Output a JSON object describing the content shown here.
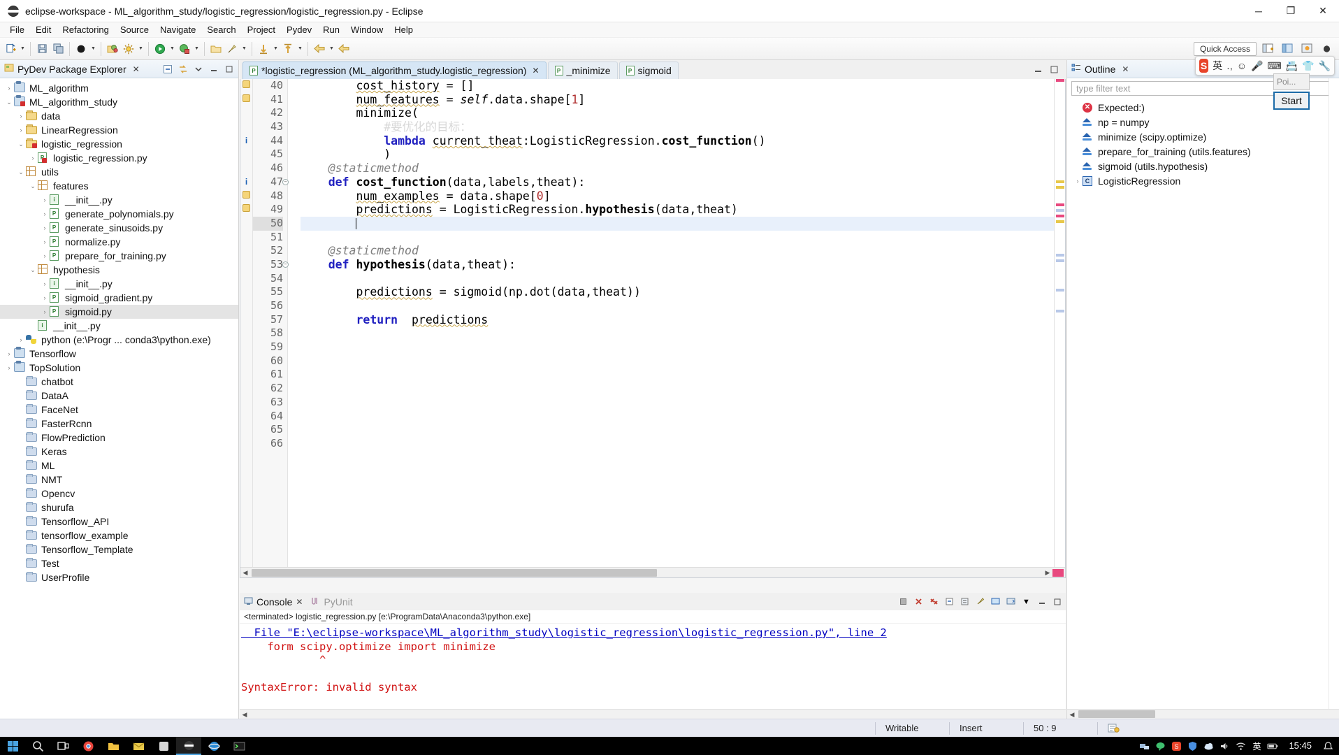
{
  "window": {
    "title": "eclipse-workspace - ML_algorithm_study/logistic_regression/logistic_regression.py - Eclipse",
    "minimize": "─",
    "maximize": "❐",
    "close": "✕"
  },
  "menubar": {
    "items": [
      "File",
      "Edit",
      "Refactoring",
      "Source",
      "Navigate",
      "Search",
      "Project",
      "Pydev",
      "Run",
      "Window",
      "Help"
    ]
  },
  "toolbar": {
    "quick_access_label": "Quick Access",
    "icons": [
      "new-wizard-icon",
      "save-icon",
      "save-all-icon",
      "debug-perspective-icon",
      "open-type-icon",
      "build-icon",
      "run-icon",
      "debug-icon",
      "open-folder-icon",
      "pin-icon",
      "next-annotation-icon",
      "previous-annotation-icon",
      "back-icon",
      "forward-icon"
    ]
  },
  "package_explorer": {
    "title": "PyDev Package Explorer",
    "tools": [
      "collapse-all-icon",
      "link-with-editor-icon",
      "view-menu-icon",
      "minimize-icon",
      "maximize-icon"
    ],
    "tree": [
      {
        "label": "ML_algorithm",
        "indent": 0,
        "twist": "›",
        "icon": "project-icon"
      },
      {
        "label": "ML_algorithm_study",
        "indent": 0,
        "twist": "⌄",
        "icon": "project-error-icon"
      },
      {
        "label": "data",
        "indent": 1,
        "twist": "›",
        "icon": "folder-icon"
      },
      {
        "label": "LinearRegression",
        "indent": 1,
        "twist": "›",
        "icon": "folder-icon"
      },
      {
        "label": "logistic_regression",
        "indent": 1,
        "twist": "⌄",
        "icon": "folder-error-icon"
      },
      {
        "label": "logistic_regression.py",
        "indent": 2,
        "twist": "›",
        "icon": "python-file-error-icon"
      },
      {
        "label": "utils",
        "indent": 1,
        "twist": "⌄",
        "icon": "package-icon"
      },
      {
        "label": "features",
        "indent": 2,
        "twist": "⌄",
        "icon": "package-icon"
      },
      {
        "label": "__init__.py",
        "indent": 3,
        "twist": "›",
        "icon": "python-init-icon"
      },
      {
        "label": "generate_polynomials.py",
        "indent": 3,
        "twist": "›",
        "icon": "python-file-icon"
      },
      {
        "label": "generate_sinusoids.py",
        "indent": 3,
        "twist": "›",
        "icon": "python-file-icon"
      },
      {
        "label": "normalize.py",
        "indent": 3,
        "twist": "›",
        "icon": "python-file-icon"
      },
      {
        "label": "prepare_for_training.py",
        "indent": 3,
        "twist": "›",
        "icon": "python-file-icon"
      },
      {
        "label": "hypothesis",
        "indent": 2,
        "twist": "⌄",
        "icon": "package-icon"
      },
      {
        "label": "__init__.py",
        "indent": 3,
        "twist": "›",
        "icon": "python-init-icon"
      },
      {
        "label": "sigmoid_gradient.py",
        "indent": 3,
        "twist": "›",
        "icon": "python-file-icon"
      },
      {
        "label": "sigmoid.py",
        "indent": 3,
        "twist": "›",
        "icon": "python-file-icon",
        "selected": true
      },
      {
        "label": "__init__.py",
        "indent": 2,
        "twist": "",
        "icon": "python-init-icon"
      },
      {
        "label": "python  (e:\\Progr ... conda3\\python.exe)",
        "indent": 1,
        "twist": "›",
        "icon": "python-interpreter-icon"
      },
      {
        "label": "Tensorflow",
        "indent": 0,
        "twist": "›",
        "icon": "project-icon"
      },
      {
        "label": "TopSolution",
        "indent": 0,
        "twist": "›",
        "icon": "project-icon"
      },
      {
        "label": "chatbot",
        "indent": 1,
        "twist": "",
        "icon": "working-folder-icon"
      },
      {
        "label": "DataA",
        "indent": 1,
        "twist": "",
        "icon": "working-folder-icon"
      },
      {
        "label": "FaceNet",
        "indent": 1,
        "twist": "",
        "icon": "working-folder-icon"
      },
      {
        "label": "FasterRcnn",
        "indent": 1,
        "twist": "",
        "icon": "working-folder-icon"
      },
      {
        "label": "FlowPrediction",
        "indent": 1,
        "twist": "",
        "icon": "working-folder-icon"
      },
      {
        "label": "Keras",
        "indent": 1,
        "twist": "",
        "icon": "working-folder-icon"
      },
      {
        "label": "ML",
        "indent": 1,
        "twist": "",
        "icon": "working-folder-icon"
      },
      {
        "label": "NMT",
        "indent": 1,
        "twist": "",
        "icon": "working-folder-icon"
      },
      {
        "label": "Opencv",
        "indent": 1,
        "twist": "",
        "icon": "working-folder-icon"
      },
      {
        "label": "shurufa",
        "indent": 1,
        "twist": "",
        "icon": "working-folder-icon"
      },
      {
        "label": "Tensorflow_API",
        "indent": 1,
        "twist": "",
        "icon": "working-folder-icon"
      },
      {
        "label": "tensorflow_example",
        "indent": 1,
        "twist": "",
        "icon": "working-folder-icon"
      },
      {
        "label": "Tensorflow_Template",
        "indent": 1,
        "twist": "",
        "icon": "working-folder-icon"
      },
      {
        "label": "Test",
        "indent": 1,
        "twist": "",
        "icon": "working-folder-icon"
      },
      {
        "label": "UserProfile",
        "indent": 1,
        "twist": "",
        "icon": "working-folder-icon"
      }
    ]
  },
  "editor": {
    "tabs": [
      {
        "label": "*logistic_regression (ML_algorithm_study.logistic_regression)",
        "active": true,
        "closable": true
      },
      {
        "label": "_minimize",
        "active": false,
        "closable": false
      },
      {
        "label": "sigmoid",
        "active": false,
        "closable": false
      }
    ],
    "first_line": 40,
    "lines": [
      {
        "n": 40,
        "marker": "warn",
        "fold": false
      },
      {
        "n": 41,
        "marker": "warn",
        "fold": false
      },
      {
        "n": 42,
        "marker": "",
        "fold": false
      },
      {
        "n": 43,
        "marker": "",
        "fold": false
      },
      {
        "n": 44,
        "marker": "info",
        "fold": false
      },
      {
        "n": 45,
        "marker": "",
        "fold": false
      },
      {
        "n": 46,
        "marker": "",
        "fold": false
      },
      {
        "n": 47,
        "marker": "info",
        "fold": true
      },
      {
        "n": 48,
        "marker": "warn",
        "fold": false
      },
      {
        "n": 49,
        "marker": "warn",
        "fold": false
      },
      {
        "n": 50,
        "marker": "",
        "fold": false,
        "current": true
      },
      {
        "n": 51,
        "marker": "",
        "fold": false
      },
      {
        "n": 52,
        "marker": "",
        "fold": false
      },
      {
        "n": 53,
        "marker": "",
        "fold": true
      },
      {
        "n": 54,
        "marker": "",
        "fold": false
      },
      {
        "n": 55,
        "marker": "",
        "fold": false
      },
      {
        "n": 56,
        "marker": "",
        "fold": false
      },
      {
        "n": 57,
        "marker": "",
        "fold": false
      },
      {
        "n": 58,
        "marker": "",
        "fold": false
      },
      {
        "n": 59,
        "marker": "",
        "fold": false
      },
      {
        "n": 60,
        "marker": "",
        "fold": false
      },
      {
        "n": 61,
        "marker": "",
        "fold": false
      },
      {
        "n": 62,
        "marker": "",
        "fold": false
      },
      {
        "n": 63,
        "marker": "",
        "fold": false
      },
      {
        "n": 64,
        "marker": "",
        "fold": false
      },
      {
        "n": 65,
        "marker": "",
        "fold": false
      },
      {
        "n": 66,
        "marker": "",
        "fold": false
      }
    ],
    "code_text": [
      "        cost_history = []",
      "        num_features = self.data.shape[1]",
      "        minimize(",
      "            #要优化的目标：",
      "            lambda current_theat:LogisticRegression.cost_function()",
      "            )",
      "    @staticmethod",
      "    def cost_function(data,labels,theat):",
      "        num_examples = data.shape[0]",
      "        predictions = LogisticRegression.hypothesis(data,theat)",
      "        ",
      "",
      "    @staticmethod",
      "    def hypothesis(data,theat):",
      "",
      "        predictions = sigmoid(np.dot(data,theat))",
      "",
      "        return  predictions",
      "",
      "",
      "",
      "",
      "",
      "",
      "",
      "",
      ""
    ]
  },
  "console": {
    "tabs": [
      {
        "label": "Console",
        "active": true
      },
      {
        "label": "PyUnit",
        "active": false
      }
    ],
    "header": "<terminated> logistic_regression.py [e:\\ProgramData\\Anaconda3\\python.exe]",
    "lines": [
      {
        "text": "  File \"E:\\eclipse-workspace\\ML_algorithm_study\\logistic_regression\\logistic_regression.py\", line 2",
        "kind": "link"
      },
      {
        "text": "    form scipy.optimize import minimize",
        "kind": "err"
      },
      {
        "text": "            ^",
        "kind": "err"
      },
      {
        "text": "",
        "kind": "err"
      },
      {
        "text": "SyntaxError: invalid syntax",
        "kind": "err"
      }
    ],
    "tools": [
      "terminate-icon",
      "remove-launch-icon",
      "remove-all-icon",
      "clear-console-icon",
      "scroll-lock-icon",
      "pin-console-icon",
      "display-selected-console-icon",
      "open-console-icon",
      "minimize-icon",
      "maximize-icon"
    ]
  },
  "outline": {
    "title": "Outline",
    "filter_placeholder": "type filter text",
    "items": [
      {
        "label": "Expected:)",
        "icon": "error-icon"
      },
      {
        "label": "np = numpy",
        "icon": "import-icon"
      },
      {
        "label": "minimize (scipy.optimize)",
        "icon": "import-icon"
      },
      {
        "label": "prepare_for_training (utils.features)",
        "icon": "import-icon"
      },
      {
        "label": "sigmoid (utils.hypothesis)",
        "icon": "import-icon"
      },
      {
        "label": "LogisticRegression",
        "icon": "class-icon",
        "twist": "›"
      }
    ]
  },
  "ime": {
    "logo": "S",
    "items": [
      "英",
      "․,",
      "☺",
      "🎤",
      "⌨",
      "📇",
      "👕",
      "🔧"
    ]
  },
  "popup": {
    "field_text": "Poi...",
    "button_label": "Start"
  },
  "statusbar": {
    "writable": "Writable",
    "insert": "Insert",
    "position": "50 : 9",
    "icon": "smart-insert-icon"
  },
  "taskbar": {
    "items": [
      "start-icon",
      "search-icon",
      "task-view-icon",
      "chrome-icon",
      "explorer-icon",
      "mail-icon",
      "app-icon",
      "ie-icon",
      "folder-icon",
      "eclipse-icon",
      "terminal-icon"
    ],
    "tray": [
      "network-icon",
      "chat-icon",
      "shield-icon",
      "cloud-icon",
      "volume-icon",
      "wifi-icon",
      "ime-icon",
      "battery-icon"
    ],
    "time": "15:45",
    "ime_label": "英"
  },
  "colors": {
    "accent": "#1c6ba8",
    "error": "#d01010",
    "link": "#0000c0",
    "keyword": "#7f0055",
    "selection": "#e8f0fb",
    "warning": "#f5d57a"
  }
}
